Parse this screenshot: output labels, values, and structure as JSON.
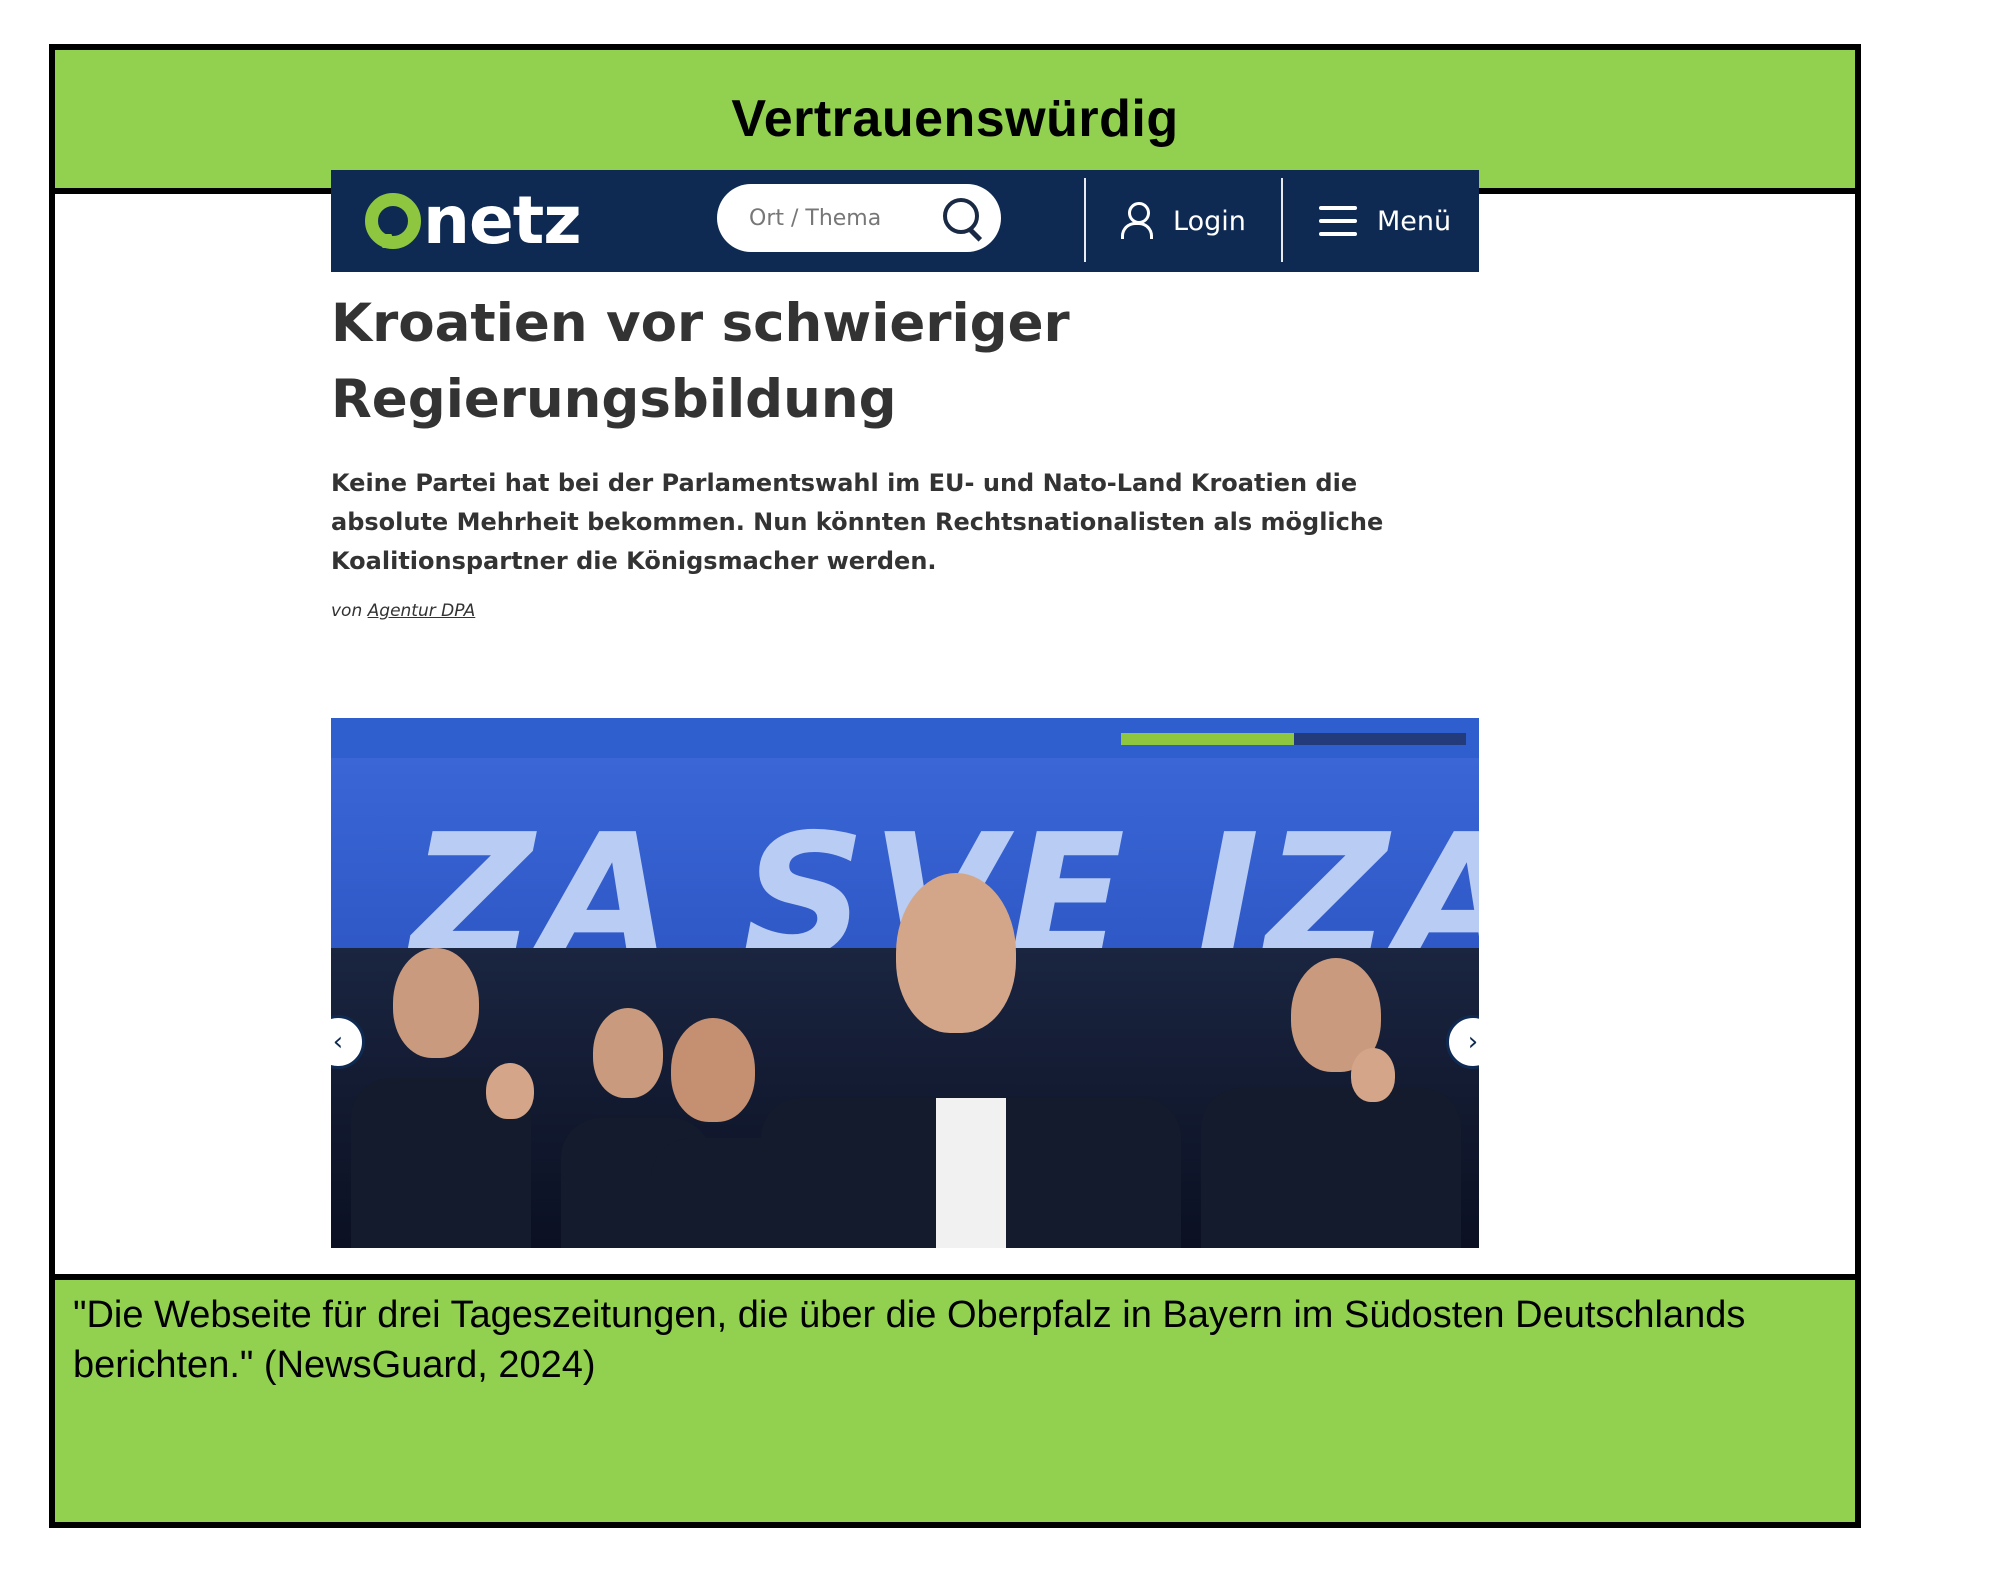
{
  "verdict": {
    "title": "Vertrauenswürdig",
    "color": "#92d050"
  },
  "site": {
    "logo_text": "netz",
    "logo_accent_color": "#8ec63f",
    "navbar_color": "#0f2a52",
    "search": {
      "placeholder": "Ort / Thema",
      "icon": "search-icon"
    },
    "login_label": "Login",
    "menu_label": "Menü"
  },
  "article": {
    "headline": "Kroatien vor schwieriger Regierungsbildung",
    "lead": "Keine Partei hat bei der Parlamentswahl im EU- und Nato-Land Kroatien die absolute Mehrheit bekommen. Nun könnten Rechtsnationalisten als mögliche Koalitionspartner die Königsmacher werden.",
    "byline_prefix": "von",
    "byline_author": "Agentur DPA",
    "gallery": {
      "banner_text": "ZA SVE IZA Z",
      "progress": 0.5,
      "prev_icon": "chevron-left-icon",
      "next_icon": "chevron-right-icon"
    }
  },
  "description": {
    "quote": "\"Die Webseite für drei Tageszeitungen, die über die Oberpfalz in Bayern im Südosten Deutschlands berichten.\" (NewsGuard, 2024)"
  }
}
